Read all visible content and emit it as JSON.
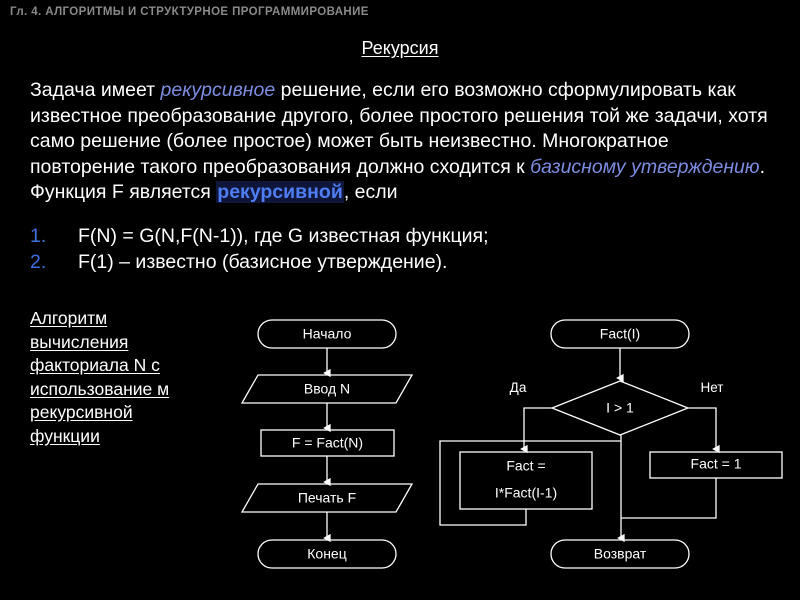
{
  "header": {
    "chapter": "Гл. 4. АЛГОРИТМЫ И СТРУКТУРНОЕ ПРОГРАММИРОВАНИЕ",
    "title": "Рекурсия"
  },
  "body": {
    "p1_a": "Задача имеет ",
    "p1_em1": "рекурсивное",
    "p1_b": " решение, если его возможно сформулировать как известное преобразование другого, более простого решения той же задачи, хотя само решение (более простое) может быть неизвестно. Многократное повторение такого преобразования должно сходится к ",
    "p1_em2": "базисному утверждению",
    "p1_c": ". Функция F является ",
    "p1_em3": "рекурсивной",
    "p1_d": ", если"
  },
  "list": [
    {
      "marker": "1.",
      "text": "F(N) = G(N,F(N-1)), где G известная функция;"
    },
    {
      "marker": "2.",
      "text": "F(1) – известно (базисное утверждение)."
    }
  ],
  "caption": {
    "text": "Алгоритм вычисления факториала N с использование м рекурсивной функции"
  },
  "flowchart_left": {
    "start": "Начало",
    "input": "Ввод N",
    "process": "F = Fact(N)",
    "output": "Печать F",
    "end": "Конец"
  },
  "flowchart_right": {
    "entry": "Fact(I)",
    "decision": "I > 1",
    "label_yes": "Да",
    "label_no": "Нет",
    "branch_yes_line1": "Fact =",
    "branch_yes_line2": "I*Fact(I-1)",
    "branch_no": "Fact = 1",
    "exit": "Возврат"
  },
  "colors": {
    "background": "#000000",
    "foreground": "#ffffff",
    "header_gray": "#8a8a8a",
    "accent_italic": "#7d8de0",
    "accent_bold": "#4f7df3",
    "accent_number": "#3f6fe0",
    "highlight_bg": "#10163a"
  }
}
